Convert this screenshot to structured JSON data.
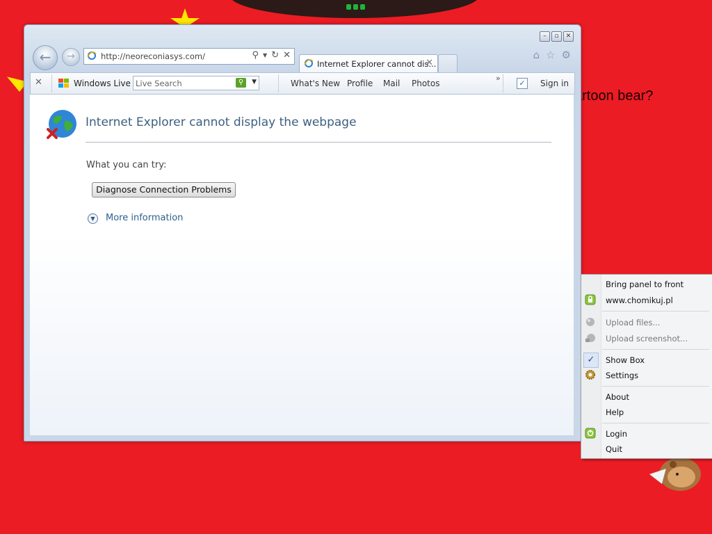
{
  "background": {
    "partial_text": "artoon bear?"
  },
  "browser": {
    "address_url": "http://neoreconiasys.com/",
    "tab_title": "Internet Explorer cannot dis...",
    "toolbar": {
      "windows_live_label": "Windows Live",
      "search_placeholder": "Live Search",
      "links": [
        "What's New",
        "Profile",
        "Mail",
        "Photos"
      ],
      "sign_in": "Sign in"
    },
    "page": {
      "error_title": "Internet Explorer cannot display the webpage",
      "try_label": "What you can try:",
      "diagnose_button": "Diagnose Connection Problems",
      "more_info": "More information"
    },
    "accent_color": "#3d5f80"
  },
  "context_menu": {
    "items": [
      {
        "label": "Bring panel to front",
        "enabled": true,
        "icon": ""
      },
      {
        "label": "www.chomikuj.pl",
        "enabled": true,
        "icon": "lock-icon"
      },
      {
        "label": "Upload files...",
        "enabled": false,
        "icon": "upload-files-icon"
      },
      {
        "label": "Upload screenshot...",
        "enabled": false,
        "icon": "upload-screenshot-icon"
      },
      {
        "label": "Show Box",
        "enabled": true,
        "icon": "checkmark-icon",
        "checked": true
      },
      {
        "label": "Settings",
        "enabled": true,
        "icon": "gear-icon"
      },
      {
        "label": "About",
        "enabled": true,
        "icon": ""
      },
      {
        "label": "Help",
        "enabled": true,
        "icon": ""
      },
      {
        "label": "Login",
        "enabled": true,
        "icon": "login-icon"
      },
      {
        "label": "Quit",
        "enabled": true,
        "icon": ""
      }
    ]
  },
  "colors": {
    "desktop_background": "#ec1c24",
    "menu_background": "#f3f4f5"
  }
}
